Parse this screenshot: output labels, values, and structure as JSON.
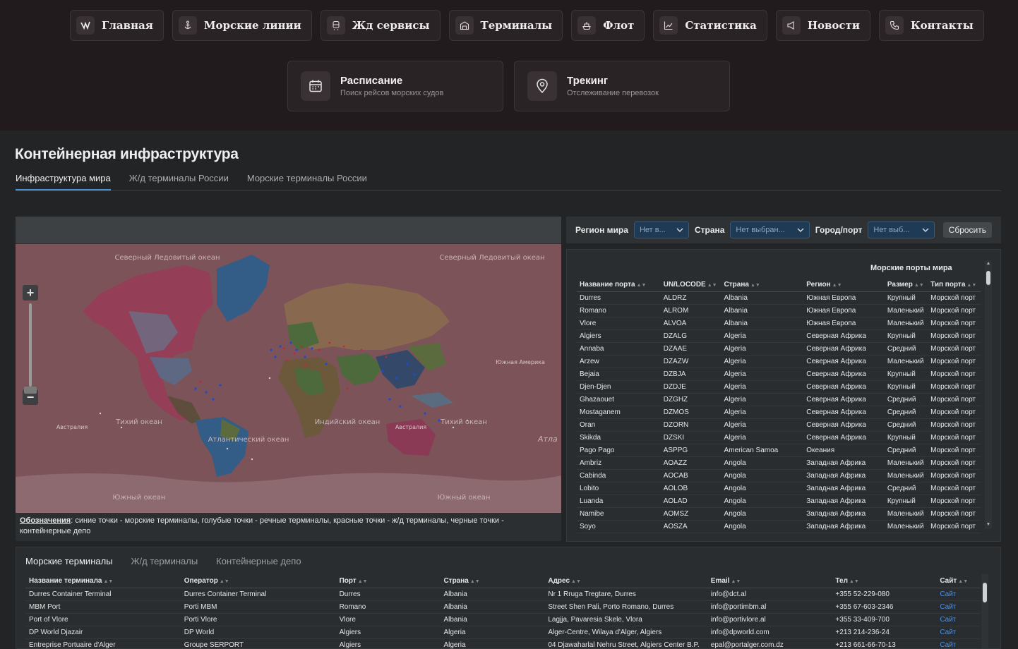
{
  "nav": [
    {
      "label": "Главная",
      "icon": "logo-icon"
    },
    {
      "label": "Морские линии",
      "icon": "anchor-icon"
    },
    {
      "label": "Жд сервисы",
      "icon": "train-icon"
    },
    {
      "label": "Терминалы",
      "icon": "warehouse-icon"
    },
    {
      "label": "Флот",
      "icon": "ship-icon"
    },
    {
      "label": "Статистика",
      "icon": "chart-icon"
    },
    {
      "label": "Новости",
      "icon": "megaphone-icon"
    },
    {
      "label": "Контакты",
      "icon": "phone-icon"
    }
  ],
  "features": [
    {
      "title": "Расписание",
      "subtitle": "Поиск рейсов морских судов",
      "icon": "calendar-icon"
    },
    {
      "title": "Трекинг",
      "subtitle": "Отслеживание перевозок",
      "icon": "location-pin-icon"
    }
  ],
  "page": {
    "title": "Контейнерная инфраструктура",
    "tabs": [
      "Инфраструктура мира",
      "Ж/д терминалы России",
      "Морские терминалы России"
    ]
  },
  "map": {
    "labels": {
      "north_ocean": "Северный Ледовитый океан",
      "north_ocean_right": "Северный Ледовитый океан",
      "south_ocean": "Южный океан",
      "south_ocean_right": "Южный океан",
      "pacific": "Тихий океан",
      "pacific_right": "Тихий океан",
      "atlantic": "Атлантический океан",
      "atlantic_right": "Атла",
      "indian": "Индийский океан",
      "australia": "Австралия",
      "australia_left": "Австралия",
      "south_america": "Южная Америка"
    },
    "legend_title": "Обозначения",
    "legend_text": ": синие точки - морские терминалы, голубые точки - речные терминалы, красные точки - ж/д терминалы, черные точки - контейнерные депо"
  },
  "filters": {
    "region_label": "Регион мира",
    "region_value": "Нет в...",
    "country_label": "Страна",
    "country_value": "Нет выбран...",
    "city_label": "Город/порт",
    "city_value": "Нет выб...",
    "reset_label": "Сбросить"
  },
  "ports": {
    "title": "Морские порты мира",
    "columns": [
      "Название порта",
      "UN/LOCODE",
      "Страна",
      "Регион",
      "Размер",
      "Тип порта"
    ],
    "rows": [
      [
        "Durres",
        "ALDRZ",
        "Albania",
        "Южная Европа",
        "Крупный",
        "Морской порт"
      ],
      [
        "Romano",
        "ALROM",
        "Albania",
        "Южная Европа",
        "Маленький",
        "Морской порт"
      ],
      [
        "Vlore",
        "ALVOA",
        "Albania",
        "Южная Европа",
        "Маленький",
        "Морской порт"
      ],
      [
        "Algiers",
        "DZALG",
        "Algeria",
        "Северная Африка",
        "Крупный",
        "Морской порт"
      ],
      [
        "Annaba",
        "DZAAE",
        "Algeria",
        "Северная Африка",
        "Средний",
        "Морской порт"
      ],
      [
        "Arzew",
        "DZAZW",
        "Algeria",
        "Северная Африка",
        "Маленький",
        "Морской порт"
      ],
      [
        "Bejaia",
        "DZBJA",
        "Algeria",
        "Северная Африка",
        "Крупный",
        "Морской порт"
      ],
      [
        "Djen-Djen",
        "DZDJE",
        "Algeria",
        "Северная Африка",
        "Крупный",
        "Морской порт"
      ],
      [
        "Ghazaouet",
        "DZGHZ",
        "Algeria",
        "Северная Африка",
        "Средний",
        "Морской порт"
      ],
      [
        "Mostaganem",
        "DZMOS",
        "Algeria",
        "Северная Африка",
        "Средний",
        "Морской порт"
      ],
      [
        "Oran",
        "DZORN",
        "Algeria",
        "Северная Африка",
        "Средний",
        "Морской порт"
      ],
      [
        "Skikda",
        "DZSKI",
        "Algeria",
        "Северная Африка",
        "Крупный",
        "Морской порт"
      ],
      [
        "Pago Pago",
        "ASPPG",
        "American Samoa",
        "Океания",
        "Средний",
        "Морской порт"
      ],
      [
        "Ambriz",
        "AOAZZ",
        "Angola",
        "Западная Африка",
        "Маленький",
        "Морской порт"
      ],
      [
        "Cabinda",
        "AOCAB",
        "Angola",
        "Западная Африка",
        "Маленький",
        "Морской порт"
      ],
      [
        "Lobito",
        "AOLOB",
        "Angola",
        "Западная Африка",
        "Средний",
        "Морской порт"
      ],
      [
        "Luanda",
        "AOLAD",
        "Angola",
        "Западная Африка",
        "Крупный",
        "Морской порт"
      ],
      [
        "Namibe",
        "AOMSZ",
        "Angola",
        "Западная Африка",
        "Маленький",
        "Морской порт"
      ],
      [
        "Soyo",
        "AOSZA",
        "Angola",
        "Западная Африка",
        "Маленький",
        "Морской порт"
      ]
    ]
  },
  "terminals": {
    "tabs": [
      "Морские терминалы",
      "Ж/д терминалы",
      "Контейнерные депо"
    ],
    "columns": [
      "Название терминала",
      "Оператор",
      "Порт",
      "Страна",
      "Адрес",
      "Email",
      "Тел",
      "Сайт"
    ],
    "rows": [
      [
        "Durres Container Terminal",
        "Durres Container Terminal",
        "Durres",
        "Albania",
        "Nr 1 Rruga Tregtare, Durres",
        "info@dct.al",
        "+355 52-229-080",
        "Сайт"
      ],
      [
        "MBM Port",
        "Porti MBM",
        "Romano",
        "Albania",
        "Street Shen Pali, Porto Romano, Durres",
        "info@portimbm.al",
        "+355 67-603-2346",
        "Сайт"
      ],
      [
        "Port of Vlore",
        "Porti Vlore",
        "Vlore",
        "Albania",
        "Lagjja, Pavaresia Skele, Vlora",
        "info@portivlore.al",
        "+355 33-409-700",
        "Сайт"
      ],
      [
        "DP World Djazair",
        "DP World",
        "Algiers",
        "Algeria",
        "Alger-Centre, Wilaya d'Alger, Algiers",
        "info@dpworld.com",
        "+213 214-236-24",
        "Сайт"
      ],
      [
        "Entreprise Portuaire d'Alger",
        "Groupe SERPORT",
        "Algiers",
        "Algeria",
        "04 Djawaharlal Nehru Street, Algiers Center B.P.",
        "epal@portalger.com.dz",
        "+213 661-66-70-13",
        "Сайт"
      ]
    ]
  }
}
